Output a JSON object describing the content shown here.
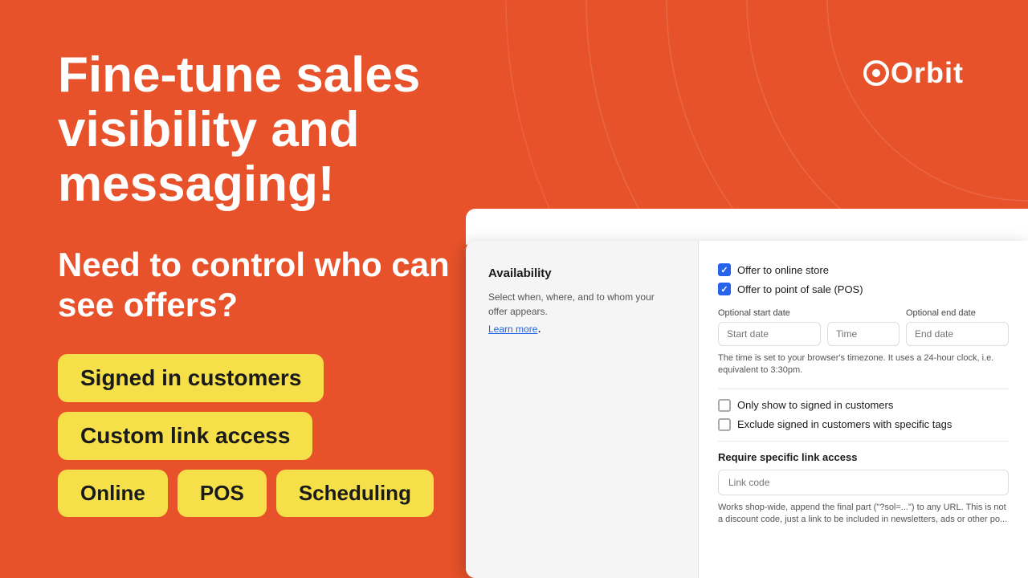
{
  "background_color": "#E8522A",
  "logo": {
    "text": "Orbit",
    "icon_char": "O"
  },
  "hero": {
    "title": "Fine-tune sales visibility and messaging!",
    "subtitle": "Need to control who can see offers?"
  },
  "pills": {
    "row1": [
      {
        "label": "Signed in customers"
      }
    ],
    "row2": [
      {
        "label": "Custom link access"
      }
    ],
    "row3": [
      {
        "label": "Online"
      },
      {
        "label": "POS"
      },
      {
        "label": "Scheduling"
      }
    ]
  },
  "panel": {
    "dots": [
      "dot1",
      "dot2",
      "dot3"
    ],
    "left": {
      "section_title": "Availability",
      "section_desc": "Select when, where, and to whom your offer appears.",
      "learn_more_label": "Learn more"
    },
    "right": {
      "checkboxes": [
        {
          "checked": true,
          "label": "Offer to online store"
        },
        {
          "checked": true,
          "label": "Offer to point of sale (POS)"
        }
      ],
      "start_date_label": "Optional start date",
      "end_date_label": "Optional end date",
      "start_date_placeholder": "Start date",
      "time_placeholder": "Time",
      "end_date_placeholder": "End date",
      "timezone_note": "The time is set to your browser's timezone. It uses a 24-hour clock, i.e. equivalent to 3:30pm.",
      "only_signed_in_label": "Only show to signed in customers",
      "exclude_signed_in_label": "Exclude signed in customers with specific tags",
      "link_access_title": "Require specific link access",
      "link_code_placeholder": "Link code",
      "link_desc": "Works shop-wide, append the final part (\"?sol=...\") to any URL. This is not a discount code, just a link to be included in newsletters, ads or other po..."
    }
  }
}
